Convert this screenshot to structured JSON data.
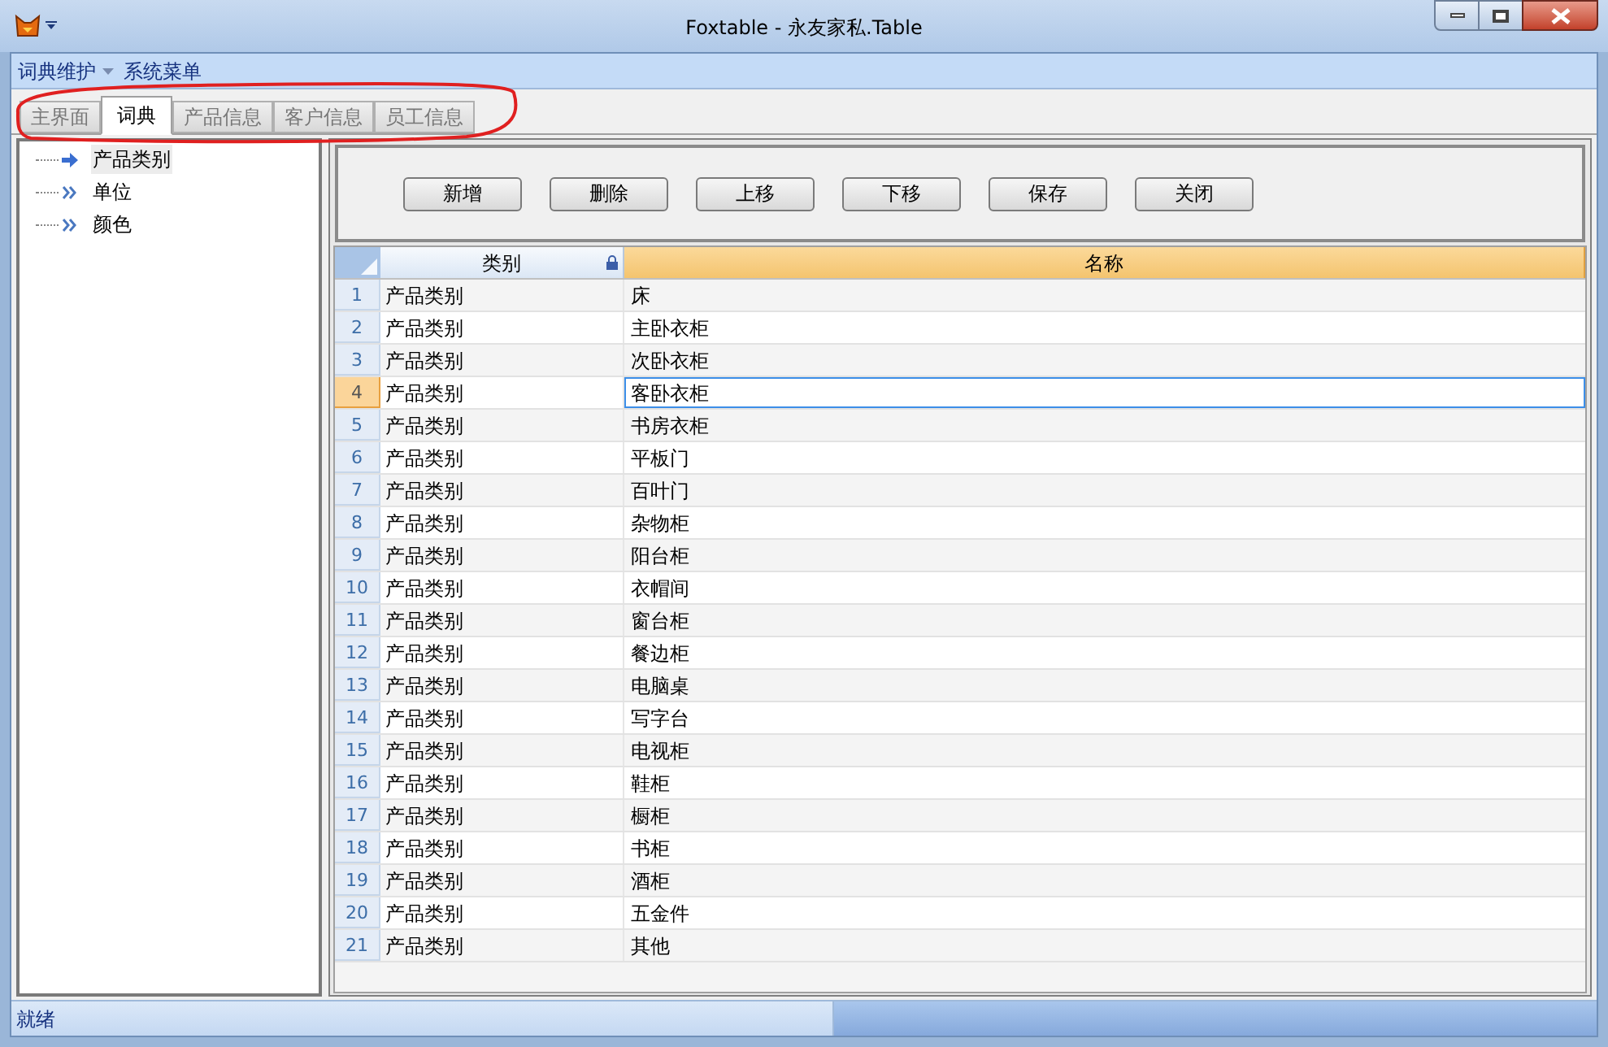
{
  "window": {
    "title": "Foxtable - 永友家私.Table"
  },
  "menu": [
    {
      "label": "词典维护",
      "dropdown": true
    },
    {
      "label": "系统菜单",
      "dropdown": false
    }
  ],
  "tabs": [
    {
      "label": "主界面",
      "selected": false
    },
    {
      "label": "词典",
      "selected": true
    },
    {
      "label": "产品信息",
      "selected": false
    },
    {
      "label": "客户信息",
      "selected": false
    },
    {
      "label": "员工信息",
      "selected": false
    }
  ],
  "tree": [
    {
      "label": "产品类别",
      "selected": true
    },
    {
      "label": "单位",
      "selected": false
    },
    {
      "label": "颜色",
      "selected": false
    }
  ],
  "buttons": [
    "新增",
    "删除",
    "上移",
    "下移",
    "保存",
    "关闭"
  ],
  "table": {
    "columns": [
      {
        "label": "类别",
        "locked": true,
        "selected": false
      },
      {
        "label": "名称",
        "locked": false,
        "selected": true
      }
    ],
    "rows": [
      {
        "number": "1",
        "category": "产品类别",
        "name": "床",
        "selected": false
      },
      {
        "number": "2",
        "category": "产品类别",
        "name": "主卧衣柜",
        "selected": false
      },
      {
        "number": "3",
        "category": "产品类别",
        "name": "次卧衣柜",
        "selected": false
      },
      {
        "number": "4",
        "category": "产品类别",
        "name": "客卧衣柜",
        "selected": true
      },
      {
        "number": "5",
        "category": "产品类别",
        "name": "书房衣柜",
        "selected": false
      },
      {
        "number": "6",
        "category": "产品类别",
        "name": "平板门",
        "selected": false
      },
      {
        "number": "7",
        "category": "产品类别",
        "name": "百叶门",
        "selected": false
      },
      {
        "number": "8",
        "category": "产品类别",
        "name": "杂物柜",
        "selected": false
      },
      {
        "number": "9",
        "category": "产品类别",
        "name": "阳台柜",
        "selected": false
      },
      {
        "number": "10",
        "category": "产品类别",
        "name": "衣帽间",
        "selected": false
      },
      {
        "number": "11",
        "category": "产品类别",
        "name": "窗台柜",
        "selected": false
      },
      {
        "number": "12",
        "category": "产品类别",
        "name": "餐边柜",
        "selected": false
      },
      {
        "number": "13",
        "category": "产品类别",
        "name": "电脑桌",
        "selected": false
      },
      {
        "number": "14",
        "category": "产品类别",
        "name": "写字台",
        "selected": false
      },
      {
        "number": "15",
        "category": "产品类别",
        "name": "电视柜",
        "selected": false
      },
      {
        "number": "16",
        "category": "产品类别",
        "name": "鞋柜",
        "selected": false
      },
      {
        "number": "17",
        "category": "产品类别",
        "name": "橱柜",
        "selected": false
      },
      {
        "number": "18",
        "category": "产品类别",
        "name": "书柜",
        "selected": false
      },
      {
        "number": "19",
        "category": "产品类别",
        "name": "酒柜",
        "selected": false
      },
      {
        "number": "20",
        "category": "产品类别",
        "name": "五金件",
        "selected": false
      },
      {
        "number": "21",
        "category": "产品类别",
        "name": "其他",
        "selected": false
      }
    ]
  },
  "status_bar": {
    "text": "就绪"
  }
}
